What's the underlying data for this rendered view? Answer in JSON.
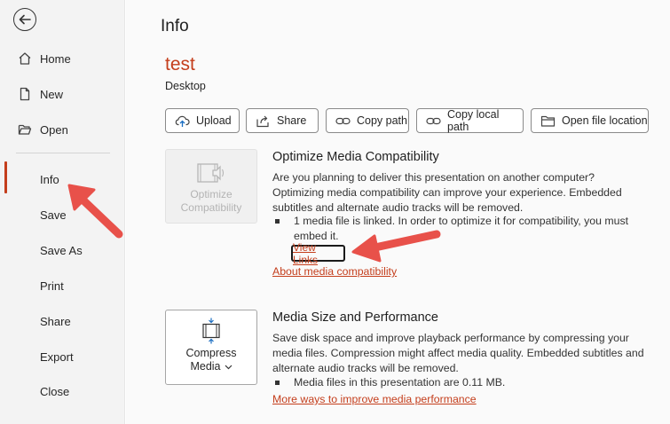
{
  "sidebar": {
    "items": [
      {
        "label": "Home",
        "icon": "home-icon"
      },
      {
        "label": "New",
        "icon": "new-document-icon"
      },
      {
        "label": "Open",
        "icon": "open-folder-icon"
      },
      {
        "label": "Info",
        "active": true
      },
      {
        "label": "Save"
      },
      {
        "label": "Save As"
      },
      {
        "label": "Print"
      },
      {
        "label": "Share"
      },
      {
        "label": "Export"
      },
      {
        "label": "Close"
      }
    ]
  },
  "page": {
    "title": "Info",
    "doc_name": "test",
    "location": "Desktop"
  },
  "actions": [
    {
      "label": "Upload",
      "icon": "upload-cloud-icon"
    },
    {
      "label": "Share",
      "icon": "share-icon"
    },
    {
      "label": "Copy path",
      "icon": "link-icon"
    },
    {
      "label": "Copy local path",
      "icon": "link-icon"
    },
    {
      "label": "Open file location",
      "icon": "folder-icon"
    }
  ],
  "optimize": {
    "button_line1": "Optimize",
    "button_line2": "Compatibility",
    "title": "Optimize Media Compatibility",
    "description": "Are you planning to deliver this presentation on another computer? Optimizing media compatibility can improve your experience. Embedded subtitles and alternate audio tracks will be removed.",
    "bullet": "1 media file is linked. In order to optimize it for compatibility, you must embed it.",
    "view_links": "View Links",
    "about_link": "About media compatibility"
  },
  "compress": {
    "button_line1": "Compress",
    "button_line2": "Media",
    "title": "Media Size and Performance",
    "description": "Save disk space and improve playback performance by compressing your media files. Compression might affect media quality. Embedded subtitles and alternate audio tracks will be removed.",
    "bullet": "Media files in this presentation are 0.11 MB.",
    "more_link": "More ways to improve media performance"
  },
  "colors": {
    "accent": "#c43e1c",
    "annotation_arrow": "#e8514a"
  }
}
